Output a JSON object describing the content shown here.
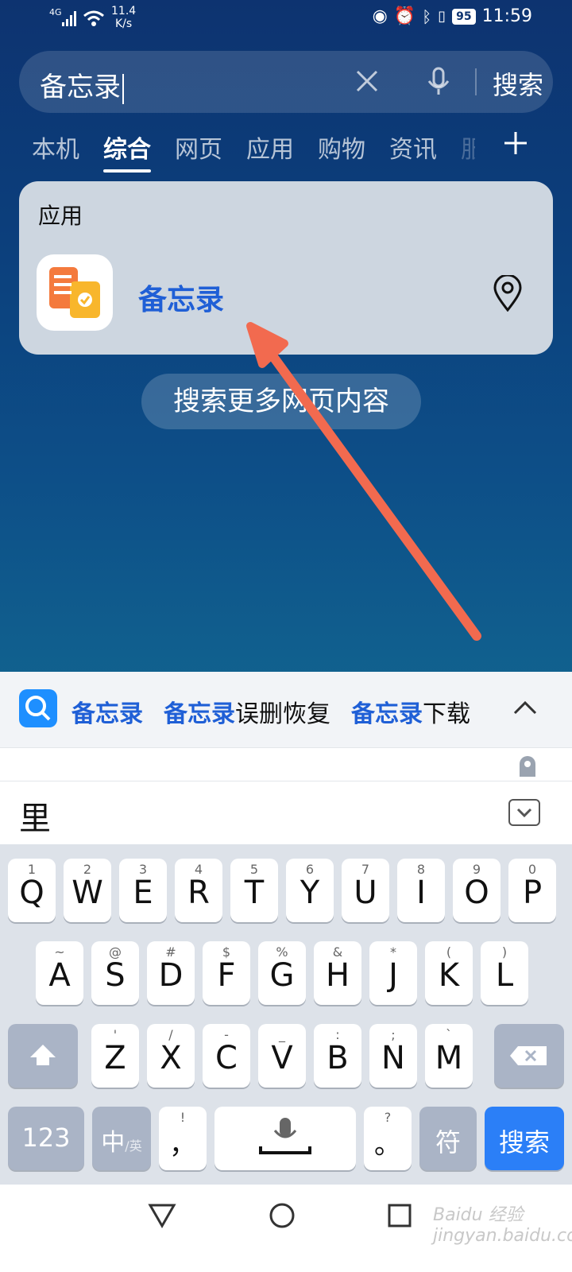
{
  "status_bar": {
    "network": "4G",
    "speed_value": "11.4",
    "speed_unit": "K/s",
    "battery": "95",
    "time": "11:59"
  },
  "search": {
    "query": "备忘录",
    "search_button": "搜索"
  },
  "tabs": [
    {
      "label": "本机"
    },
    {
      "label": "综合",
      "active": true
    },
    {
      "label": "网页"
    },
    {
      "label": "应用"
    },
    {
      "label": "购物"
    },
    {
      "label": "资讯"
    },
    {
      "label": "服"
    }
  ],
  "apps_card": {
    "title": "应用",
    "app_name": "备忘录"
  },
  "more_button": "搜索更多网页内容",
  "suggestions": [
    {
      "highlight": "备忘录",
      "rest": ""
    },
    {
      "highlight": "备忘录",
      "rest": "误删恢复"
    },
    {
      "highlight": "备忘录",
      "rest": "下载"
    }
  ],
  "candidate": "里",
  "keyboard": {
    "row1": [
      {
        "main": "Q",
        "sub": "1"
      },
      {
        "main": "W",
        "sub": "2"
      },
      {
        "main": "E",
        "sub": "3"
      },
      {
        "main": "R",
        "sub": "4"
      },
      {
        "main": "T",
        "sub": "5"
      },
      {
        "main": "Y",
        "sub": "6"
      },
      {
        "main": "U",
        "sub": "7"
      },
      {
        "main": "I",
        "sub": "8"
      },
      {
        "main": "O",
        "sub": "9"
      },
      {
        "main": "P",
        "sub": "0"
      }
    ],
    "row2": [
      {
        "main": "A",
        "sub": "~"
      },
      {
        "main": "S",
        "sub": "@"
      },
      {
        "main": "D",
        "sub": "#"
      },
      {
        "main": "F",
        "sub": "$"
      },
      {
        "main": "G",
        "sub": "%"
      },
      {
        "main": "H",
        "sub": "&"
      },
      {
        "main": "J",
        "sub": "*"
      },
      {
        "main": "K",
        "sub": "("
      },
      {
        "main": "L",
        "sub": ")"
      }
    ],
    "row3": [
      {
        "main": "Z",
        "sub": "'"
      },
      {
        "main": "X",
        "sub": "/"
      },
      {
        "main": "C",
        "sub": "-"
      },
      {
        "main": "V",
        "sub": "_"
      },
      {
        "main": "B",
        "sub": ":"
      },
      {
        "main": "N",
        "sub": ";"
      },
      {
        "main": "M",
        "sub": "`"
      }
    ],
    "num_key": "123",
    "lang_key": "中",
    "lang_alt": "英",
    "comma_main": "，",
    "comma_sub": "!",
    "period_main": "。",
    "period_sub": "?",
    "symbol_key": "符",
    "enter_key": "搜索"
  },
  "icons": {
    "clear": "close-icon",
    "mic": "microphone-icon",
    "add": "plus-icon",
    "pin": "location-pin-icon",
    "expand": "chevron-up-icon",
    "shift": "shift-icon",
    "backspace": "backspace-icon"
  },
  "colors": {
    "accent": "#2b7ff7",
    "highlight": "#1f5fd6",
    "arrow": "#f26a4f"
  },
  "watermark": "Baidu 经验 jingyan.baidu.com"
}
